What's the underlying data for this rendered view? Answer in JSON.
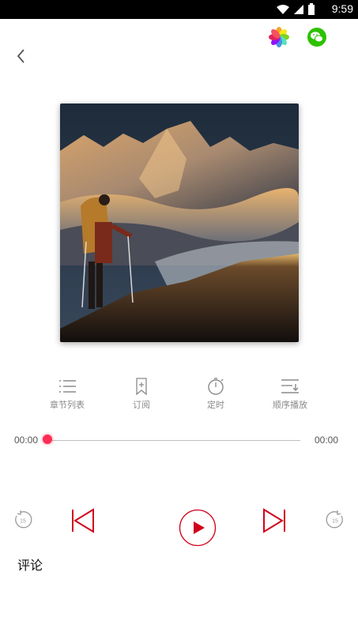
{
  "status": {
    "time": "9:59"
  },
  "header": {
    "back_icon": "chevron-left-icon",
    "share_photos_icon": "photos-icon",
    "share_wechat_icon": "wechat-icon"
  },
  "tools": [
    {
      "label": "章节列表",
      "icon": "list-icon"
    },
    {
      "label": "订阅",
      "icon": "bookmark-icon"
    },
    {
      "label": "定时",
      "icon": "timer-icon"
    },
    {
      "label": "顺序播放",
      "icon": "playlist-order-icon"
    }
  ],
  "player": {
    "current_time": "00:00",
    "total_time": "00:00",
    "progress": 0
  },
  "controls": {
    "rewind_label": "15",
    "forward_label": "15"
  },
  "comments": {
    "title": "评论"
  },
  "colors": {
    "accent": "#d0021b",
    "knob": "#ff2d55",
    "icon_gray": "#8a8a8a"
  }
}
